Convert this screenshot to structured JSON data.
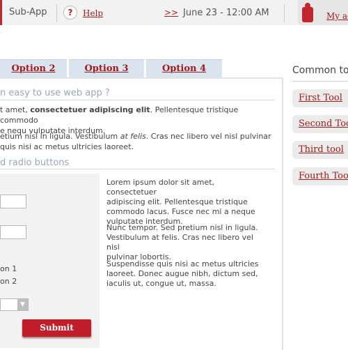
{
  "header": {
    "app_name": "Sub-App",
    "help_icon": "?",
    "help_label": "Help",
    "date_arrows": ">>",
    "datetime": "June 23 - 12:00 AM",
    "account_label": "My ac"
  },
  "tabs": [
    {
      "label": "Option 2"
    },
    {
      "label": "Option 3"
    },
    {
      "label": "Option 4"
    }
  ],
  "main": {
    "section1_title": "n easy to use web app ?",
    "p1_a": "t amet, ",
    "p1_bold": "consectetuer adipiscing elit",
    "p1_b": ". Pellentesque tristique commodo",
    "p1_line2": "e nequ vulputate interdum.",
    "p2_line1_a": "etium nisl in ligula. Vestibulum ",
    "p2_italic": "at felis",
    "p2_line1_b": ". Cras nec libero vel nisl pulvinar",
    "p2_line2": "quis nisi ac metus ultricies laoreet.",
    "section2_title": "d radio buttons",
    "form": {
      "radio1_label": "on 1",
      "radio2_label": "on 2",
      "submit_label": "Submit"
    },
    "right_text": {
      "para1": [
        "Lorem ipsum dolor sit amet, consectetuer",
        "adipiscing elit. Pellentesque tristique",
        "commodo lacus. Fusce nec mi a neque",
        "vulputate interdum."
      ],
      "para2": [
        "Nunc tempor. Sed pretium nisl in ligula.",
        "Vestibulum at felis. Cras nec libero vel nisl",
        "pulvinar lobortis."
      ],
      "para3": [
        "Suspendisse quis nisi ac metus ultricies",
        "laoreet. Donec augue nibh, dictum sed,",
        "iaculis ut, congue ut, massa."
      ]
    }
  },
  "sidebar": {
    "title": "Common to",
    "tools": [
      {
        "label": "First Tool"
      },
      {
        "label": "Second Tool"
      },
      {
        "label": "Third tool"
      },
      {
        "label": "Fourth Tool"
      }
    ]
  },
  "colors": {
    "accent": "#c0262c",
    "link": "#a01b1b",
    "tab_bg": "#d9e4ee",
    "section_title": "#9aa7b8"
  },
  "icons": [
    "help-icon",
    "user-icon",
    "select-arrow-icon"
  ]
}
